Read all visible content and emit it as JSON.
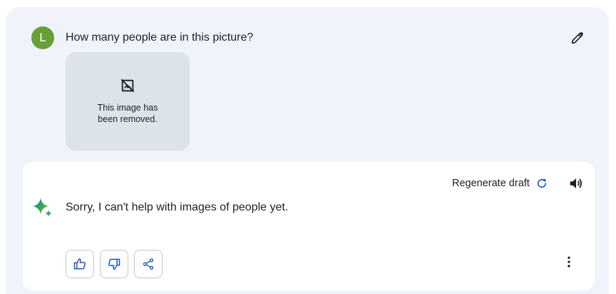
{
  "user_query": {
    "avatar_letter": "L",
    "text": "How many people are in this picture?",
    "edit_icon": "pencil-icon",
    "attachment": {
      "icon": "image-removed-icon",
      "message": "This image has been removed."
    }
  },
  "response": {
    "regenerate_label": "Regenerate draft",
    "regenerate_icon": "refresh-icon",
    "speaker_icon": "speaker-icon",
    "assistant_icon": "sparkle-icon",
    "text": "Sorry, I can't help with images of people yet.",
    "actions": [
      {
        "name": "thumbs-up",
        "icon": "thumbs-up-icon"
      },
      {
        "name": "thumbs-down",
        "icon": "thumbs-down-icon"
      },
      {
        "name": "share",
        "icon": "share-icon"
      }
    ],
    "more_icon": "more-vert-icon"
  },
  "colors": {
    "panel_bg": "#f0f4fa",
    "avatar_bg": "#689f38",
    "accent_blue": "#1a56c4",
    "image_placeholder_bg": "#dde3ea"
  }
}
